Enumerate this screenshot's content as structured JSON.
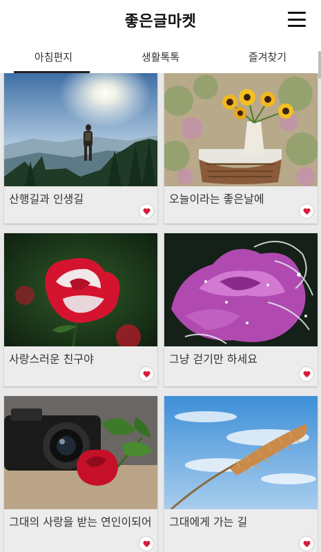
{
  "app": {
    "title": "좋은글마켓"
  },
  "tabs": [
    {
      "label": "아침편지",
      "active": true
    },
    {
      "label": "생활톡톡",
      "active": false
    },
    {
      "label": "즐겨찾기",
      "active": false
    }
  ],
  "cards": [
    {
      "title": "산행길과 인생길",
      "image": "mountain-hiker"
    },
    {
      "title": "오늘이라는 좋은날에",
      "image": "sunflower-vase"
    },
    {
      "title": "사랑스러운 친구야",
      "image": "red-rose"
    },
    {
      "title": "그냥 걷기만 하세요",
      "image": "purple-rose-splash"
    },
    {
      "title": "그대의 사랑을 받는 연인이되어",
      "image": "camera-rose"
    },
    {
      "title": "그대에게 가는 길",
      "image": "grass-sky"
    }
  ],
  "colors": {
    "heart": "#d81b3c",
    "card_bg": "#ececec",
    "page_bg": "#e9e9e9"
  },
  "icons": {
    "menu": "hamburger-menu-icon",
    "favorite": "heart-icon"
  }
}
